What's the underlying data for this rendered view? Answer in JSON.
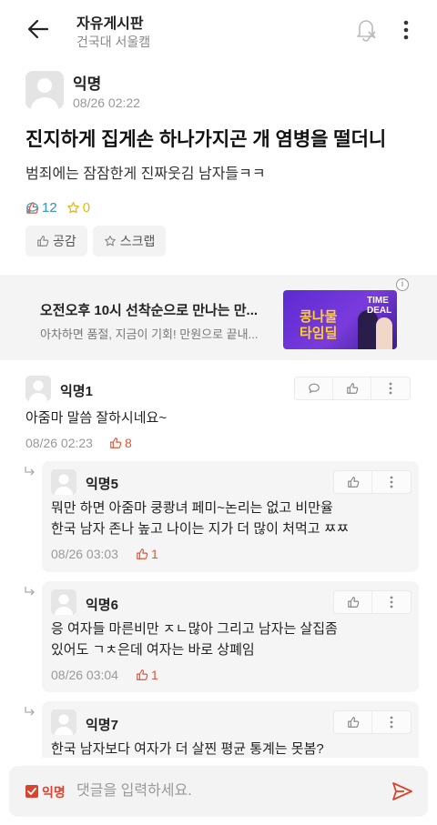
{
  "header": {
    "board_name": "자유게시판",
    "campus": "건국대 서울캠"
  },
  "post": {
    "author": "익명",
    "time": "08/26 02:22",
    "title": "진지하게 집게손 하나가지곤 개 염병을 떨더니",
    "body": "범죄에는 잠잠한게 진짜웃김 남자들ㅋㅋ",
    "likes": "12",
    "comments": "12",
    "scraps": "0",
    "like_button": "공감",
    "scrap_button": "스크랩"
  },
  "ad": {
    "title": "오전오후 10시 선착순으로 만나는 만...",
    "description": "아차하면 품절, 지금이 기회! 만원으로 끝내...",
    "image_text_1": "콩나물",
    "image_text_2": "타임딜",
    "image_badge": "TIME DEAL",
    "info": "i"
  },
  "comments": [
    {
      "author": "익명1",
      "text": [
        "아줌마 말씀 잘하시네요~"
      ],
      "time": "08/26 02:23",
      "likes": "8"
    },
    {
      "author": "익명5",
      "text": [
        "뭐만 하면 아줌마 쿵쾅녀 페미~논리는 없고 비만율",
        "한국 남자 존나 높고 나이는 지가 더 많이 처먹고 ㅉㅉ"
      ],
      "time": "08/26 03:03",
      "likes": "1"
    },
    {
      "author": "익명6",
      "text": [
        "응 여자들 마른비만 ㅈㄴ많아 그리고 남자는 살집좀",
        "있어도 ㄱㅊ은데 여자는 바로 상폐임"
      ],
      "time": "08/26 03:04",
      "likes": "1"
    },
    {
      "author": "익명7",
      "text": [
        "한국 남자보다 여자가 더 살찐 평균 통계는 못봄?"
      ]
    }
  ],
  "composer": {
    "anon_label": "익명",
    "placeholder": "댓글을 입력하세요."
  },
  "colors": {
    "accent_red": "#d9442e",
    "like": "#d9573b",
    "comment": "#3da0c8",
    "scrap": "#e8b41c"
  },
  "icons": [
    "back-arrow-icon",
    "bell-off-icon",
    "more-vertical-icon",
    "thumb-up-icon",
    "speech-bubble-icon",
    "star-icon",
    "reply-arrow-icon",
    "send-icon"
  ]
}
